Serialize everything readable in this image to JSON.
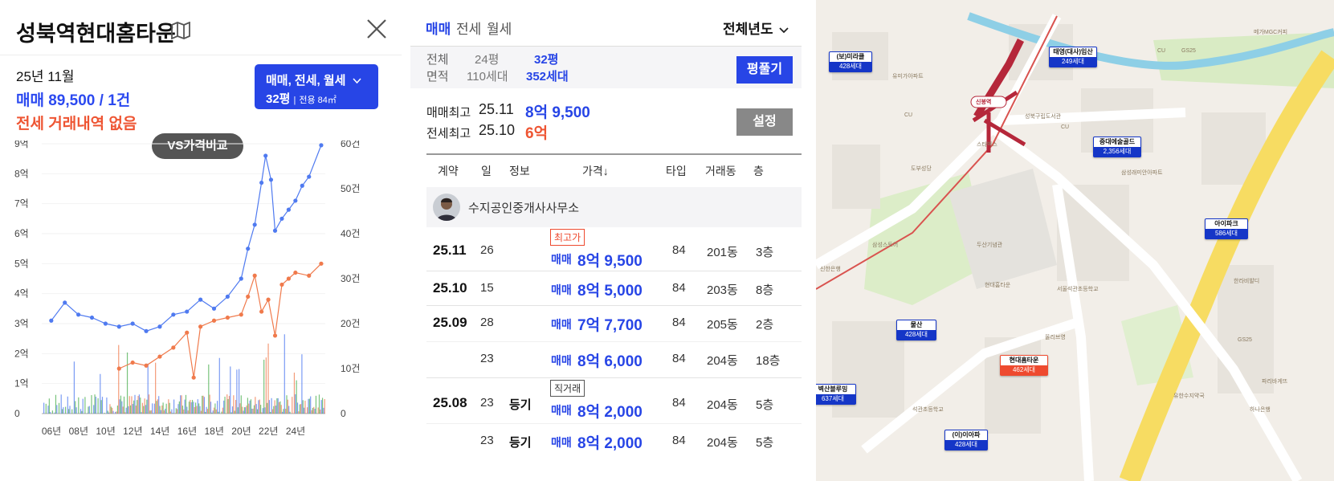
{
  "complex": {
    "title": "성북역현대홈타운",
    "map_icon": "map-icon",
    "close_icon": "close-icon"
  },
  "summary": {
    "date": "25년 11월",
    "sale": "매매 89,500 / 1건",
    "jeonse": "전세 거래내역 없음"
  },
  "filter": {
    "types": "매매, 전세, 월세",
    "size": "32평",
    "exclusive": "전용 84㎡"
  },
  "vs_button": "VS가격비교",
  "chart_data": {
    "type": "line",
    "left_axis_ticks": [
      "9억",
      "8억",
      "7억",
      "6억",
      "5억",
      "4억",
      "3억",
      "2억",
      "1억",
      "0"
    ],
    "right_axis_ticks": [
      "60건",
      "50건",
      "40건",
      "30건",
      "20건",
      "10건",
      "0"
    ],
    "x_ticks": [
      "06년",
      "08년",
      "10년",
      "12년",
      "14년",
      "16년",
      "18년",
      "20년",
      "22년",
      "24년"
    ],
    "series": [
      {
        "color": "#4f7af0",
        "x": [
          2006,
          2007,
          2008,
          2009,
          2010,
          2011,
          2012,
          2013,
          2014,
          2015,
          2016,
          2017,
          2018,
          2019,
          2020,
          2020.5,
          2021,
          2021.5,
          2021.8,
          2022.2,
          2022.5,
          2023,
          2023.5,
          2024,
          2024.5,
          2025,
          2025.9
        ],
        "y": [
          3.1,
          3.7,
          3.3,
          3.2,
          3.0,
          2.9,
          3.0,
          2.75,
          2.9,
          3.3,
          3.4,
          3.8,
          3.5,
          3.9,
          4.5,
          5.5,
          6.3,
          7.7,
          8.6,
          7.8,
          6.1,
          6.5,
          6.8,
          7.1,
          7.6,
          7.9,
          8.95
        ]
      },
      {
        "color": "#f07a4c",
        "x": [
          2011,
          2012,
          2013,
          2014,
          2015,
          2016,
          2016.5,
          2017,
          2018,
          2019,
          2020,
          2020.5,
          2021,
          2021.5,
          2022,
          2022.5,
          2023,
          2023.5,
          2024,
          2025,
          2025.9
        ],
        "y": [
          1.5,
          1.7,
          1.6,
          1.9,
          2.2,
          2.7,
          1.2,
          2.9,
          3.1,
          3.2,
          3.3,
          3.9,
          4.6,
          3.4,
          3.8,
          2.6,
          4.3,
          4.5,
          4.7,
          4.6,
          5.0
        ]
      }
    ],
    "volume_colors": [
      "#4f7af0",
      "#f07a4c",
      "#4caf50"
    ]
  },
  "tabs": [
    {
      "label": "매매",
      "active": true
    },
    {
      "label": "전세",
      "active": false
    },
    {
      "label": "월세",
      "active": false
    }
  ],
  "year_select": "전체년도",
  "area_info": {
    "label1": "전체",
    "label2": "면적",
    "p1": "24평",
    "h1": "110세대",
    "p2": "32평",
    "h2": "352세대"
  },
  "pyeong_button": "평풀기",
  "max": {
    "sale_label": "매매최고",
    "sale_date": "25.11",
    "sale_price": "8억 9,500",
    "jeonse_label": "전세최고",
    "jeonse_date": "25.10",
    "jeonse_price": "6억"
  },
  "settings_button": "설정",
  "table_headers": {
    "contract": "계약",
    "day": "일",
    "info": "정보",
    "price": "가격↓",
    "type": "타입",
    "dong": "거래동",
    "floor": "층"
  },
  "agent": "수지공인중개사사무소",
  "rows": [
    {
      "ym": "25.11",
      "day": "26",
      "info": "",
      "badge": "최고가",
      "kind": "매매",
      "price": "8억 9,500",
      "type": "84",
      "dong": "201동",
      "floor": "3층"
    },
    {
      "ym": "25.10",
      "day": "15",
      "info": "",
      "badge": "",
      "kind": "매매",
      "price": "8억 5,000",
      "type": "84",
      "dong": "203동",
      "floor": "8층"
    },
    {
      "ym": "25.09",
      "day": "28",
      "info": "",
      "badge": "",
      "kind": "매매",
      "price": "7억 7,700",
      "type": "84",
      "dong": "205동",
      "floor": "2층"
    },
    {
      "ym": "",
      "day": "23",
      "info": "",
      "badge": "",
      "kind": "매매",
      "price": "8억 6,000",
      "type": "84",
      "dong": "204동",
      "floor": "18층"
    },
    {
      "ym": "25.08",
      "day": "23",
      "info": "등기",
      "badge": "직거래",
      "kind": "매매",
      "price": "8억 2,000",
      "type": "84",
      "dong": "204동",
      "floor": "5층"
    },
    {
      "ym": "",
      "day": "23",
      "info": "등기",
      "badge": "",
      "kind": "매매",
      "price": "8억 2,000",
      "type": "84",
      "dong": "204동",
      "floor": "5층"
    }
  ],
  "map": {
    "pills": [
      {
        "name": "(보)미라클",
        "h": "428세대"
      },
      {
        "name": "태영(대사)임산",
        "h": "249세대"
      },
      {
        "name": "중대에술골드",
        "h": "2,356세대"
      },
      {
        "name": "아이파크",
        "h": "586세대"
      },
      {
        "name": "물산",
        "h": "428세대"
      },
      {
        "name": "현대홈타운",
        "h": "462세대",
        "active": true
      },
      {
        "name": "벽산블루밍",
        "h": "637세대"
      },
      {
        "name": "(이)이아파",
        "h": "428세대"
      }
    ],
    "labels": [
      "CU",
      "CU",
      "스타벅스",
      "도부성당",
      "삼성스토어",
      "두산기념관",
      "현대홈타운",
      "신한은행",
      "GS25",
      "메가MGC커피",
      "성북구립도서관",
      "삼성래미안아파트",
      "유미가아파트",
      "한라비발디",
      "GS25",
      "CU",
      "하나은행",
      "석관초등학교",
      "올리브영",
      "파리바게뜨",
      "유한수지약국",
      "서울석관초등학교"
    ],
    "station": "신봉역"
  }
}
